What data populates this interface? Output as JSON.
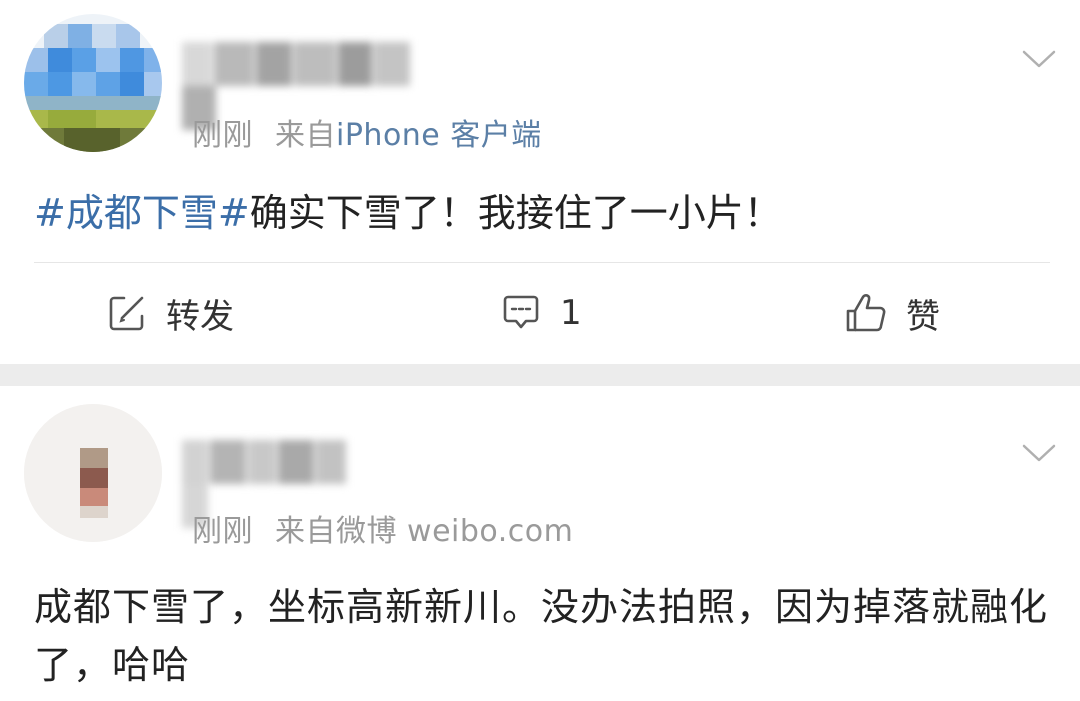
{
  "posts": [
    {
      "time": "刚刚",
      "source_prefix": "来自",
      "source": "iPhone 客户端",
      "content": {
        "topic": "#成都下雪#",
        "text": "确实下雪了！我接住了一小片！"
      },
      "actions": {
        "repost_label": "转发",
        "comment_count": "1",
        "like_label": "赞"
      }
    },
    {
      "time": "刚刚",
      "source_prefix": "来自",
      "source": "微博 weibo.com",
      "content": {
        "text": "成都下雪了，坐标高新新川。没办法拍照，因为掉落就融化了，哈哈"
      }
    }
  ],
  "icons": {
    "repost": "edit-square-icon",
    "comment": "comment-bubble-icon",
    "like": "thumbs-up-icon",
    "menu": "chevron-down-icon"
  },
  "colors": {
    "topic_link": "#3b6ea8",
    "meta_text": "#9a9a9a",
    "source_link": "#5b7fa6",
    "body_text": "#222222",
    "separator": "#ececec"
  }
}
